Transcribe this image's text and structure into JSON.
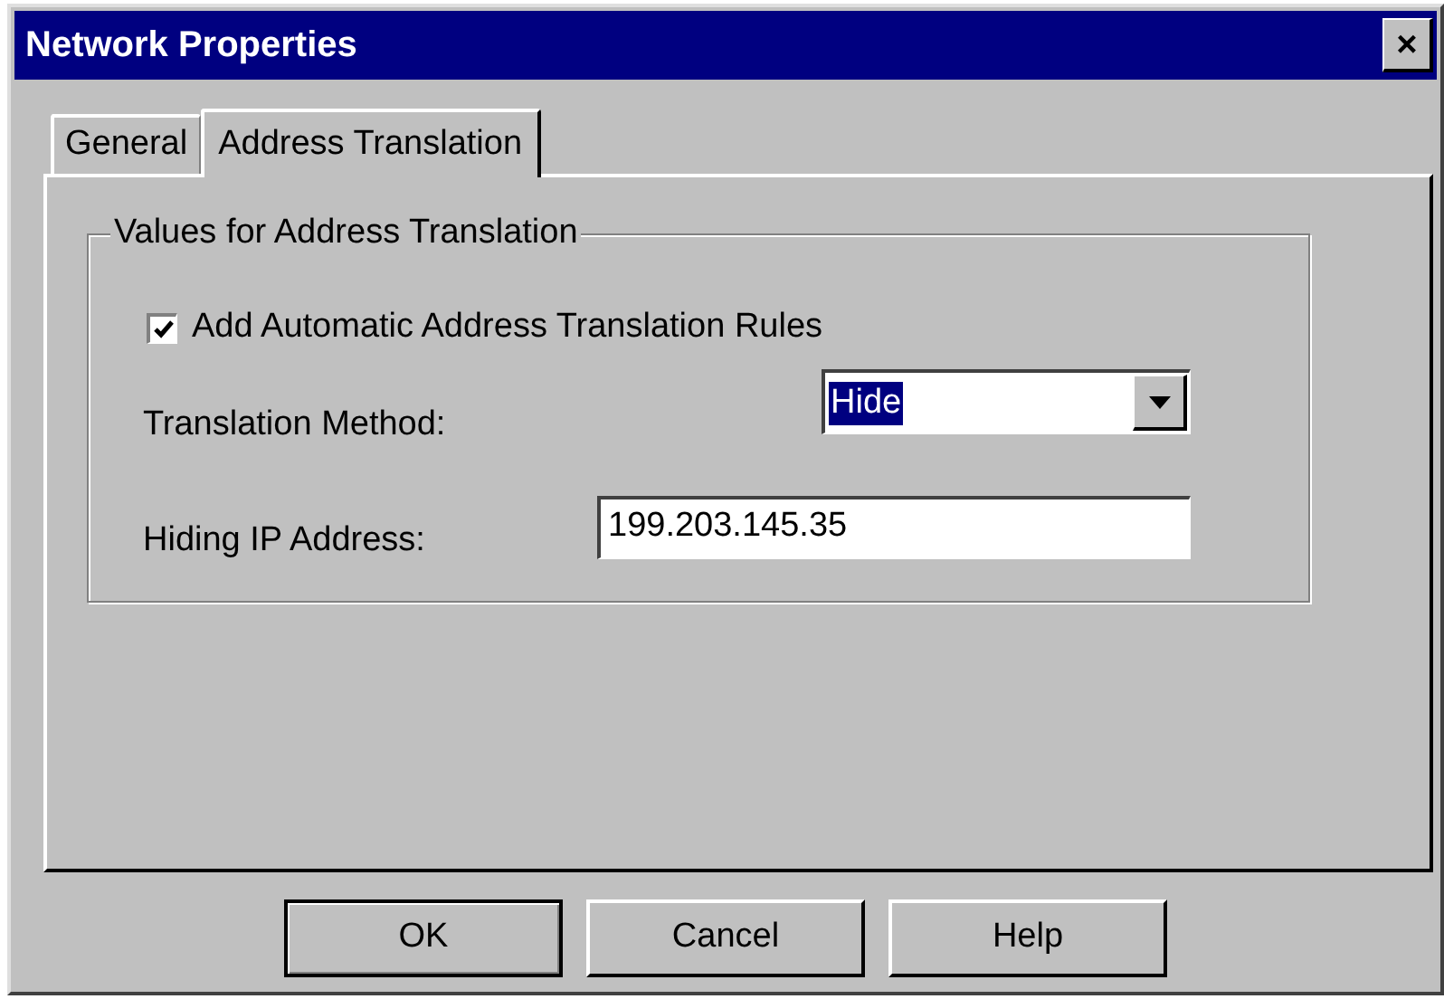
{
  "window": {
    "title": "Network Properties",
    "close": "×"
  },
  "tabs": [
    {
      "label": "General",
      "selected": false
    },
    {
      "label": "Address Translation",
      "selected": true
    }
  ],
  "group": {
    "title": "Values for Address Translation",
    "checkbox": {
      "label": "Add Automatic Address Translation Rules",
      "checked": true
    },
    "method": {
      "label": "Translation Method:",
      "value": "Hide"
    },
    "ip": {
      "label": "Hiding IP Address:",
      "value": "199.203.145.35"
    }
  },
  "buttons": [
    {
      "label": "OK",
      "default": true
    },
    {
      "label": "Cancel",
      "default": false
    },
    {
      "label": "Help",
      "default": false
    }
  ]
}
